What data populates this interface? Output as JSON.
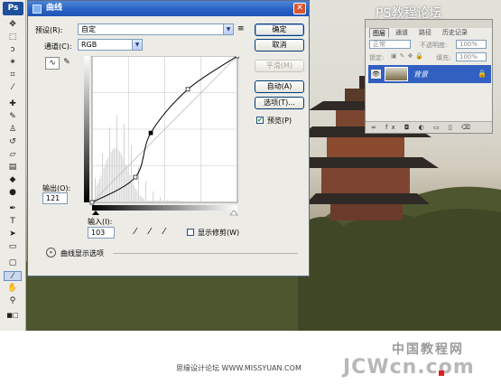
{
  "app": {
    "logo": "Ps",
    "colors": {
      "titlebar": "#2a62c4",
      "selection": "#3160c0",
      "accent_red": "#e02020"
    }
  },
  "toolbox": {
    "tools": [
      "move-icon",
      "marquee-icon",
      "lasso-icon",
      "magic-wand-icon",
      "crop-icon",
      "eyedropper-icon",
      "healing-icon",
      "brush-icon",
      "stamp-icon",
      "history-brush-icon",
      "eraser-icon",
      "gradient-icon",
      "blur-icon",
      "dodge-icon",
      "pen-icon",
      "text-icon",
      "path-select-icon",
      "shape-icon",
      "notes-icon",
      "eyedropper-tool-icon",
      "hand-icon",
      "zoom-icon"
    ]
  },
  "curves": {
    "title": "曲线",
    "preset_label": "预设(R):",
    "preset_value": "自定",
    "channel_label": "通道(C):",
    "channel_value": "RGB",
    "output_label": "输出(O):",
    "output_value": "121",
    "input_label": "输入(I):",
    "input_value": "103",
    "show_clipping": "显示修剪(W)",
    "options_toggle": "曲线显示选项",
    "buttons": {
      "ok": "确定",
      "cancel": "取消",
      "smooth": "平滑(M)",
      "auto": "自动(A)",
      "options": "选项(T)...",
      "preview": "预览(P)"
    },
    "preview_checked": true,
    "curve_points": [
      [
        0,
        0
      ],
      [
        76,
        44
      ],
      [
        103,
        121
      ],
      [
        168,
        197
      ],
      [
        255,
        255
      ]
    ]
  },
  "layers": {
    "tabs": [
      "图层",
      "通道",
      "路径",
      "历史记录"
    ],
    "blend_mode": "正常",
    "opacity_label": "不透明度:",
    "opacity_value": "100%",
    "lock_label": "锁定:",
    "fill_label": "填充:",
    "fill_value": "100%",
    "layer_name": "背景",
    "bottom_icons": "∞ fx ◘ ◐ ▭ ▯ ⌫"
  },
  "watermarks": {
    "top": "PS教程论坛",
    "footer_cn": "中国教程网",
    "footer_sub": "思缘设计论坛 WWW.MISSYUAN.COM",
    "footer_big": "JCWcn.com"
  }
}
